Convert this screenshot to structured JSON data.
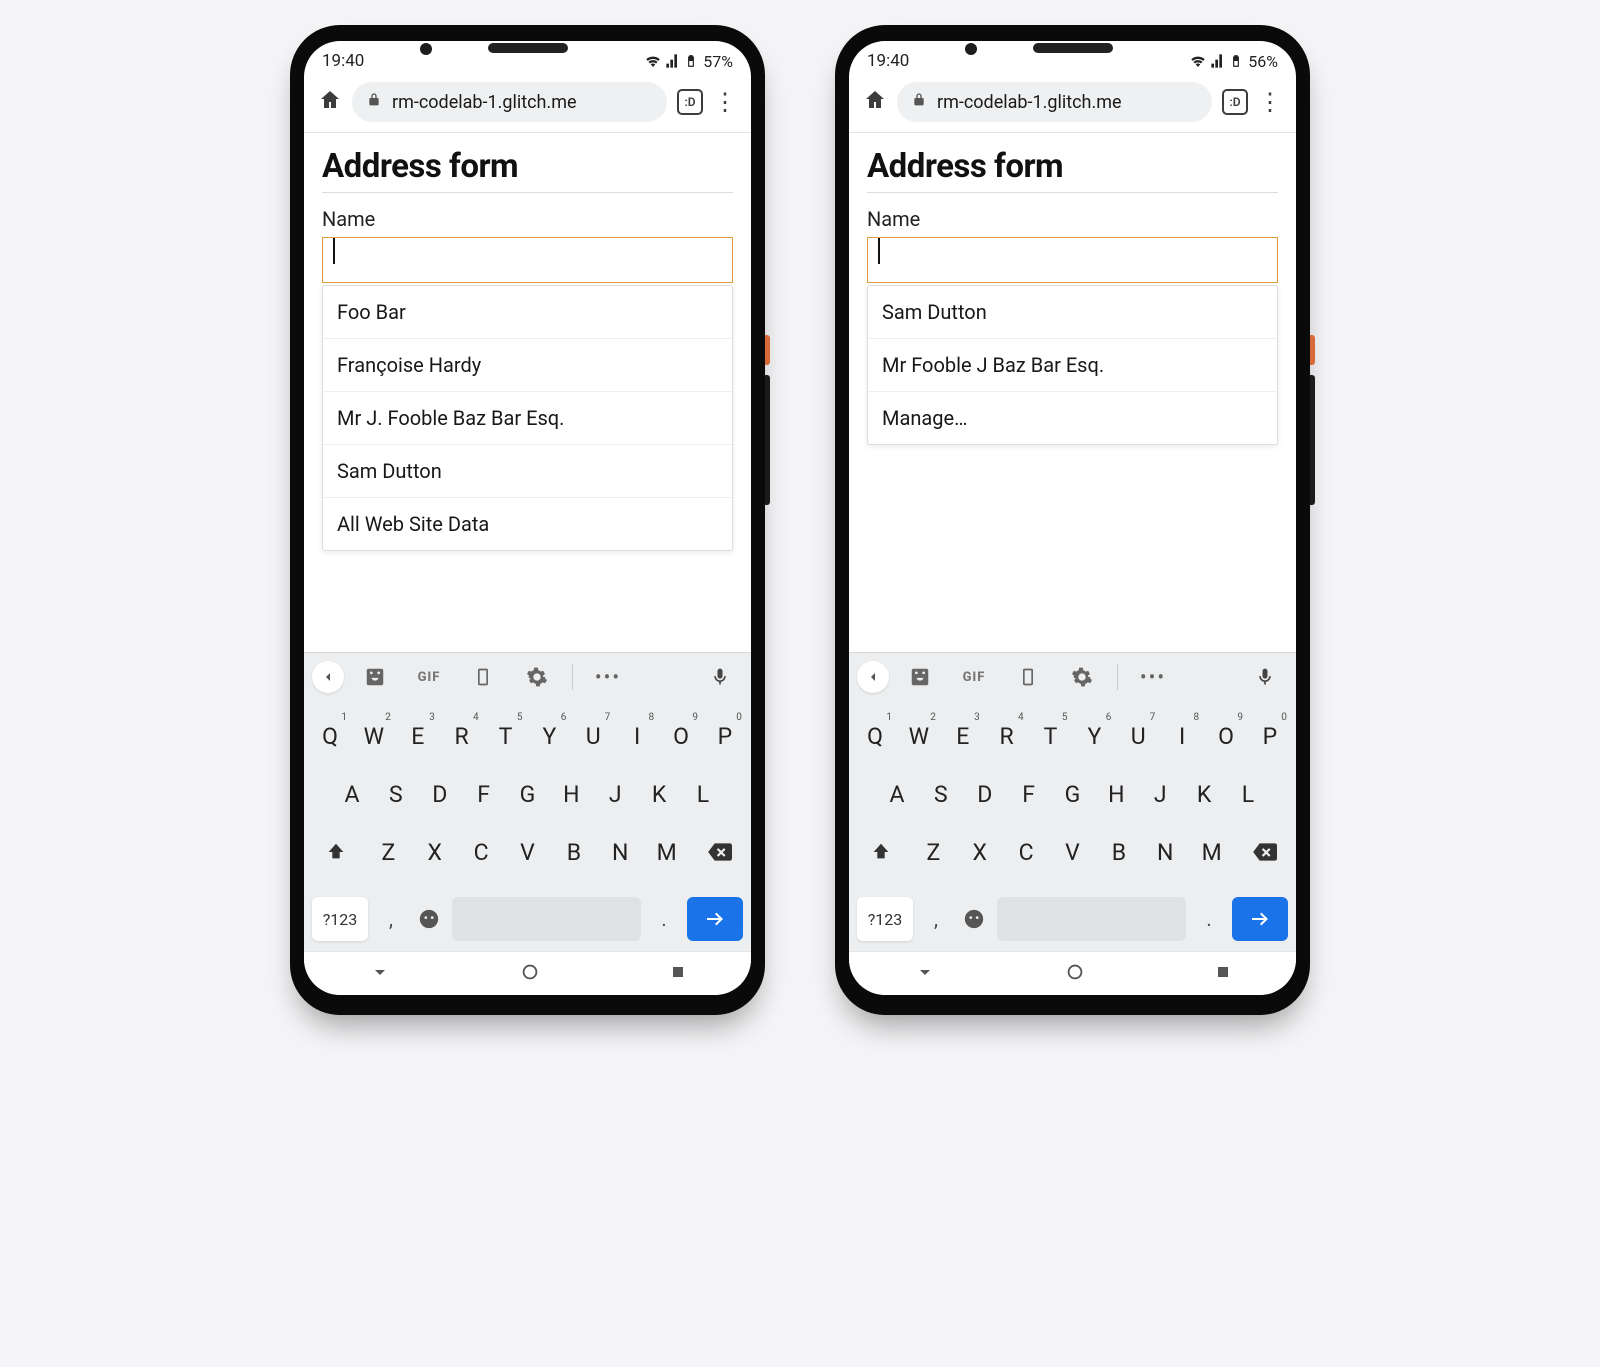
{
  "phones": [
    {
      "status": {
        "time": "19:40",
        "battery": "57%"
      },
      "browser": {
        "url": "rm-codelab-1.glitch.me",
        "tabs": ":D"
      },
      "page": {
        "title": "Address form",
        "field_label": "Name",
        "autofill": [
          "Foo Bar",
          "Françoise Hardy",
          "Mr J. Fooble Baz Bar Esq.",
          "Sam Dutton",
          "All Web Site Data"
        ]
      }
    },
    {
      "status": {
        "time": "19:40",
        "battery": "56%"
      },
      "browser": {
        "url": "rm-codelab-1.glitch.me",
        "tabs": ":D"
      },
      "page": {
        "title": "Address form",
        "field_label": "Name",
        "autofill": [
          "Sam Dutton",
          "Mr Fooble J Baz Bar Esq.",
          "Manage…"
        ]
      }
    }
  ],
  "keyboard": {
    "strip_gif": "GIF",
    "rows": [
      [
        {
          "k": "Q",
          "s": "1"
        },
        {
          "k": "W",
          "s": "2"
        },
        {
          "k": "E",
          "s": "3"
        },
        {
          "k": "R",
          "s": "4"
        },
        {
          "k": "T",
          "s": "5"
        },
        {
          "k": "Y",
          "s": "6"
        },
        {
          "k": "U",
          "s": "7"
        },
        {
          "k": "I",
          "s": "8"
        },
        {
          "k": "O",
          "s": "9"
        },
        {
          "k": "P",
          "s": "0"
        }
      ],
      [
        {
          "k": "A"
        },
        {
          "k": "S"
        },
        {
          "k": "D"
        },
        {
          "k": "F"
        },
        {
          "k": "G"
        },
        {
          "k": "H"
        },
        {
          "k": "J"
        },
        {
          "k": "K"
        },
        {
          "k": "L"
        }
      ],
      [
        {
          "k": "Z"
        },
        {
          "k": "X"
        },
        {
          "k": "C"
        },
        {
          "k": "V"
        },
        {
          "k": "B"
        },
        {
          "k": "N"
        },
        {
          "k": "M"
        }
      ]
    ],
    "sym": "?123",
    "comma": ",",
    "period": "."
  }
}
